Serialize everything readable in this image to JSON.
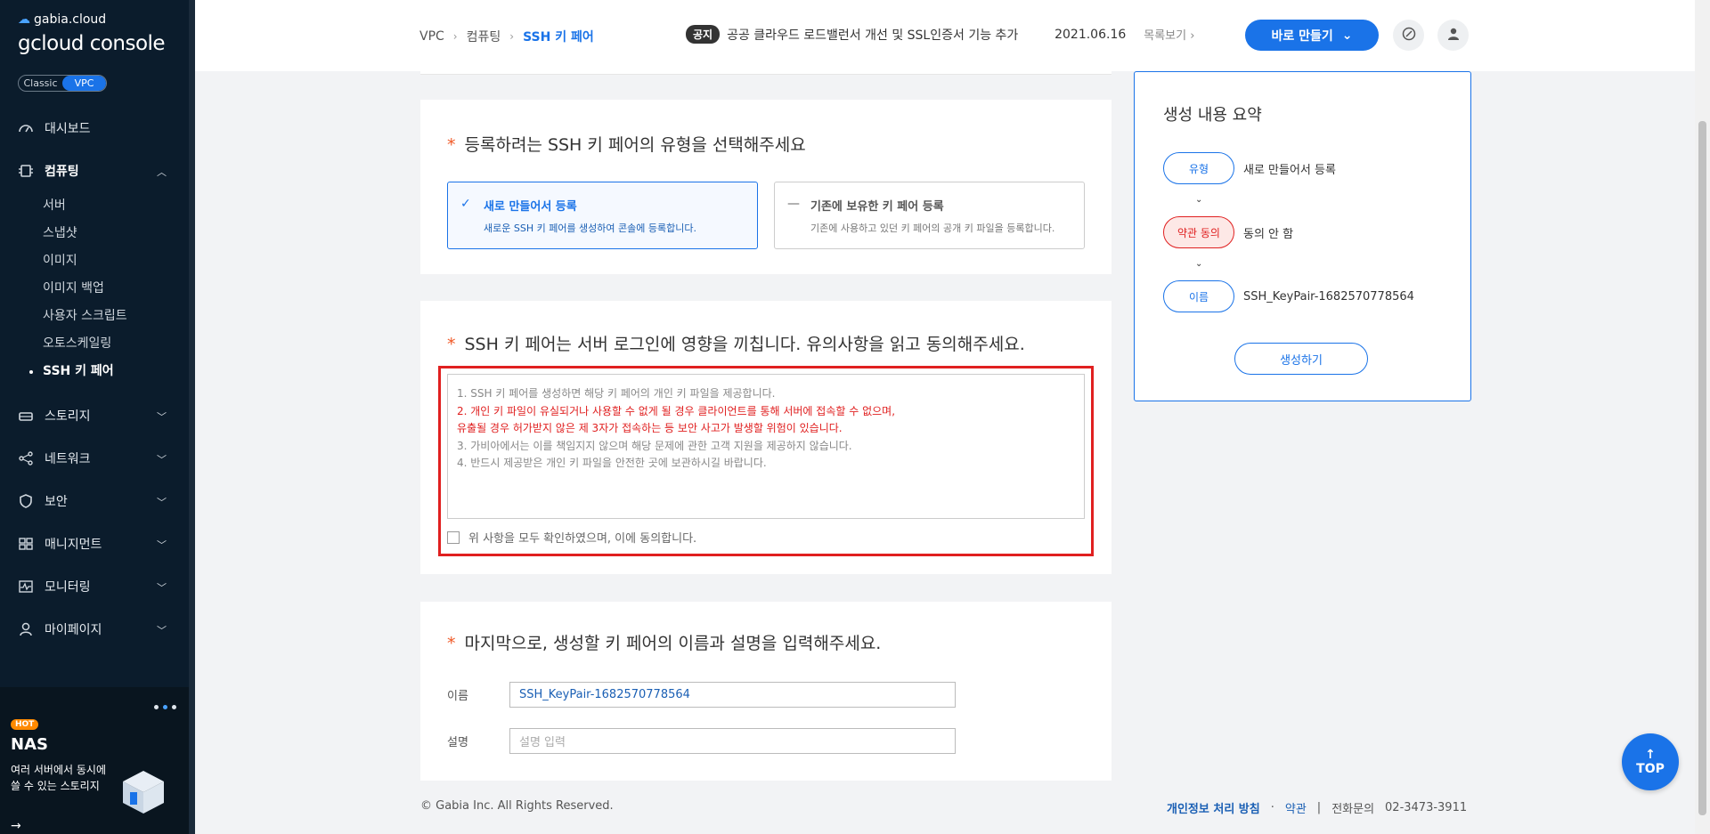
{
  "sidebar": {
    "logo_small": "gabia.cloud",
    "logo_big": "gcloud console",
    "toggle": [
      "Classic",
      "VPC"
    ],
    "items": [
      {
        "label": "대시보드",
        "icon": "speedometer-icon"
      },
      {
        "label": "컴퓨팅",
        "icon": "chip-icon",
        "expanded": true
      },
      {
        "label": "스토리지",
        "icon": "storage-icon"
      },
      {
        "label": "네트워크",
        "icon": "network-icon"
      },
      {
        "label": "보안",
        "icon": "shield-icon"
      },
      {
        "label": "매니지먼트",
        "icon": "management-icon"
      },
      {
        "label": "모니터링",
        "icon": "monitor-icon"
      },
      {
        "label": "마이페이지",
        "icon": "user-icon"
      }
    ],
    "sub_items": [
      {
        "label": "서버"
      },
      {
        "label": "스냅샷"
      },
      {
        "label": "이미지"
      },
      {
        "label": "이미지 백업"
      },
      {
        "label": "사용자 스크립트"
      },
      {
        "label": "오토스케일링"
      },
      {
        "label": "SSH 키 페어",
        "active": true
      }
    ],
    "promo": {
      "badge": "HOT",
      "title": "NAS",
      "desc": "여러 서버에서 동시에 쓸 수 있는 스토리지"
    }
  },
  "header": {
    "breadcrumb": [
      "VPC",
      "컴퓨팅",
      "SSH 키 페어"
    ],
    "notice_tag": "공지",
    "notice_text": "공공 클라우드 로드밸런서 개선 및 SSL인증서 기능 추가",
    "notice_date": "2021.06.16",
    "notice_more": "목록보기",
    "create_button": "바로 만들기"
  },
  "section1": {
    "required": "*",
    "title": "등록하려는 SSH 키 페어의 유형을 선택해주세요",
    "option_new": {
      "title": "새로 만들어서 등록",
      "desc": "새로운 SSH 키 페어를 생성하여 콘솔에 등록합니다."
    },
    "option_existing": {
      "title": "기존에 보유한 키 페어 등록",
      "desc": "기존에 사용하고 있던 키 페어의 공개 키 파일을 등록합니다."
    }
  },
  "section2": {
    "required": "*",
    "title": "SSH 키 페어는 서버 로그인에 영향을 끼칩니다. 유의사항을 읽고 동의해주세요.",
    "term1": "1. SSH 키 페어를 생성하면 해당 키 페어의 개인 키 파일을 제공합니다.",
    "term2a": "2. 개인 키 파일이 유실되거나 사용할 수 없게 될 경우 클라이언트를 통해 서버에 접속할 수 없으며,",
    "term2b": "유출될 경우 허가받지 않은 제 3자가 접속하는 등 보안 사고가 발생할 위험이 있습니다.",
    "term3": "3. 가비아에서는 이를 책임지지 않으며 해당 문제에 관한 고객 지원을 제공하지 않습니다.",
    "term4": "4. 반드시 제공받은 개인 키 파일을 안전한 곳에 보관하시길 바랍니다.",
    "agree_label": "위 사항을 모두 확인하였으며, 이에 동의합니다."
  },
  "section3": {
    "required": "*",
    "title": "마지막으로, 생성할 키 페어의 이름과 설명을 입력해주세요.",
    "name_label": "이름",
    "name_value": "SSH_KeyPair-1682570778564",
    "desc_label": "설명",
    "desc_placeholder": "설명 입력"
  },
  "summary": {
    "title": "생성 내용 요약",
    "rows": [
      {
        "pill": "유형",
        "value": "새로 만들어서 등록"
      },
      {
        "pill": "약관 동의",
        "value": "동의 안 함"
      },
      {
        "pill": "이름",
        "value": "SSH_KeyPair-1682570778564"
      }
    ],
    "button": "생성하기"
  },
  "footer": {
    "copyright": "© Gabia Inc. All Rights Reserved.",
    "privacy": "개인정보 처리 방침",
    "terms": "약관",
    "contact": "전화문의",
    "phone": "02-3473-3911"
  },
  "top_button": "TOP",
  "colors": {
    "accent": "#1a73e8",
    "warning": "#e02020",
    "sidebar": "#0b1c2c"
  }
}
